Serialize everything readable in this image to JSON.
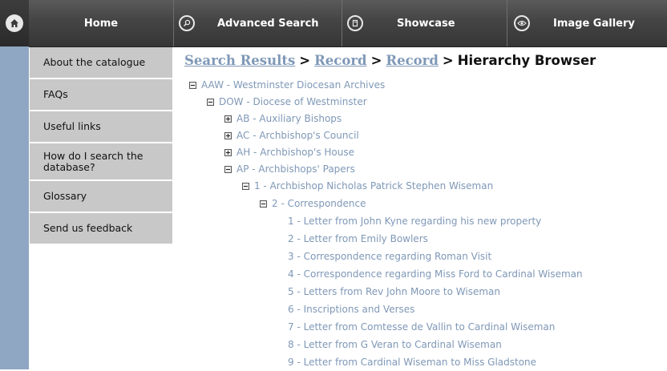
{
  "nav": {
    "home": "Home",
    "advanced_search": "Advanced Search",
    "showcase": "Showcase",
    "image_gallery": "Image Gallery"
  },
  "sidebar": {
    "items": [
      {
        "label": "About the catalogue"
      },
      {
        "label": "FAQs"
      },
      {
        "label": "Useful links"
      },
      {
        "label": "How do I search the database?"
      },
      {
        "label": "Glossary"
      },
      {
        "label": "Send us feedback"
      }
    ]
  },
  "breadcrumb": {
    "search_results": "Search Results",
    "sep": ">",
    "record1": "Record",
    "record2": "Record",
    "current": "Hierarchy Browser"
  },
  "tree": [
    {
      "label": "AAW - Westminster Diocesan Archives",
      "toggle": "minus"
    },
    {
      "label": "DOW - Diocese of Westminster",
      "toggle": "minus"
    },
    {
      "label": "AB - Auxiliary Bishops",
      "toggle": "plus"
    },
    {
      "label": "AC - Archbishop's Council",
      "toggle": "plus"
    },
    {
      "label": "AH - Archbishop's House",
      "toggle": "plus"
    },
    {
      "label": "AP - Archbishops' Papers",
      "toggle": "minus"
    },
    {
      "label": "1 - Archbishop Nicholas Patrick Stephen Wiseman",
      "toggle": "minus"
    },
    {
      "label": "2 - Correspondence",
      "toggle": "minus"
    },
    {
      "label": "1 - Letter from John Kyne regarding his new property",
      "toggle": "none"
    },
    {
      "label": "2 - Letter from Emily Bowlers",
      "toggle": "none"
    },
    {
      "label": "3 - Correspondence regarding Roman Visit",
      "toggle": "none"
    },
    {
      "label": "4 - Correspondence regarding Miss Ford to Cardinal Wiseman",
      "toggle": "none"
    },
    {
      "label": "5 - Letters from Rev John Moore to Wiseman",
      "toggle": "none"
    },
    {
      "label": "6 - Inscriptions and Verses",
      "toggle": "none"
    },
    {
      "label": "7 - Letter from Comtesse de Vallin to Cardinal Wiseman",
      "toggle": "none"
    },
    {
      "label": "8 - Letter from G Veran to Cardinal Wiseman",
      "toggle": "none"
    },
    {
      "label": "9 - Letter from Cardinal Wiseman to Miss Gladstone",
      "toggle": "none"
    }
  ],
  "colors": {
    "link": "#7f98b7",
    "nav_bg": "#444444",
    "sidebar_bg": "#c8c8c8",
    "strip": "#8fa7c2"
  }
}
